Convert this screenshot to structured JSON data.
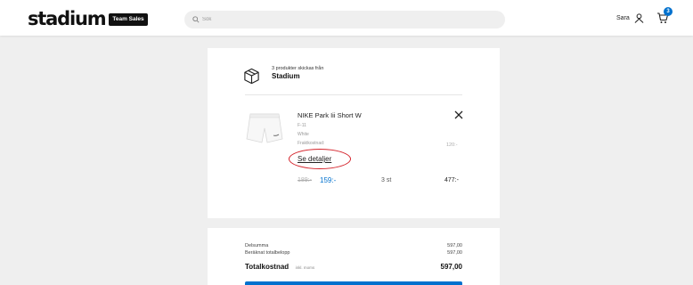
{
  "header": {
    "logo_text": "stadium",
    "logo_badge": "Team Sales",
    "search_placeholder": "Sök",
    "user_name": "Sara",
    "cart_count": "3",
    "brand_color": "#0071ce"
  },
  "cart": {
    "shipping_line": "3 produkter skickas från",
    "shipping_store": "Stadium",
    "item": {
      "name": "NIKE Park Iii Short W",
      "size": "F-11",
      "color": "White",
      "delivery_label": "Fraktkostnad:",
      "delivery_price": "120:-",
      "details_link": "Se detaljer",
      "price_old": "189:-",
      "price_new": "159:-",
      "quantity": "3 st",
      "line_total": "477:-"
    }
  },
  "summary": {
    "subtotal_label": "Delsumma",
    "subtotal_value": "597,00",
    "calc_label": "Beräknat totalbelopp",
    "calc_value": "597,00",
    "total_label": "Totalkostnad",
    "total_note": "inkl. moms",
    "total_value": "597,00"
  },
  "icons": {
    "search": "search-icon",
    "user": "user-icon",
    "cart": "cart-icon",
    "box": "box-icon",
    "close": "close-icon"
  }
}
